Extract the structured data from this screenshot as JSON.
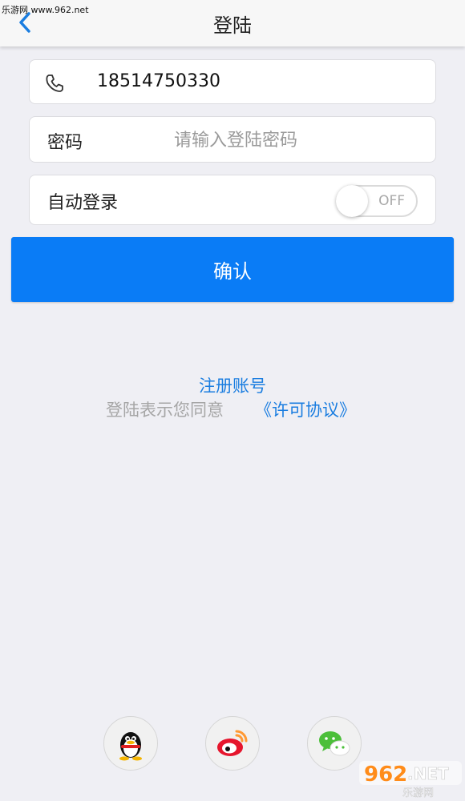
{
  "watermark_top": "乐游网 www.962.net",
  "nav": {
    "title": "登陆",
    "back_icon": "chevron-left-icon"
  },
  "phone": {
    "icon": "phone-icon",
    "value": "18514750330"
  },
  "password": {
    "label": "密码",
    "placeholder": "请输入登陆密码",
    "value": ""
  },
  "auto_login": {
    "label": "自动登录",
    "toggle_text": "OFF",
    "on": false
  },
  "confirm_label": "确认",
  "register_label": "注册账号",
  "agreement": {
    "prefix": "登陆表示您同意",
    "link": "《许可协议》"
  },
  "social": [
    {
      "name": "qq-icon"
    },
    {
      "name": "weibo-icon"
    },
    {
      "name": "wechat-icon"
    }
  ],
  "watermark_logo": {
    "number": "962",
    "suffix": ".NET",
    "caption": "乐游网"
  },
  "colors": {
    "accent": "#0a7cf6",
    "link": "#1a7de0",
    "background": "#efeff4"
  }
}
